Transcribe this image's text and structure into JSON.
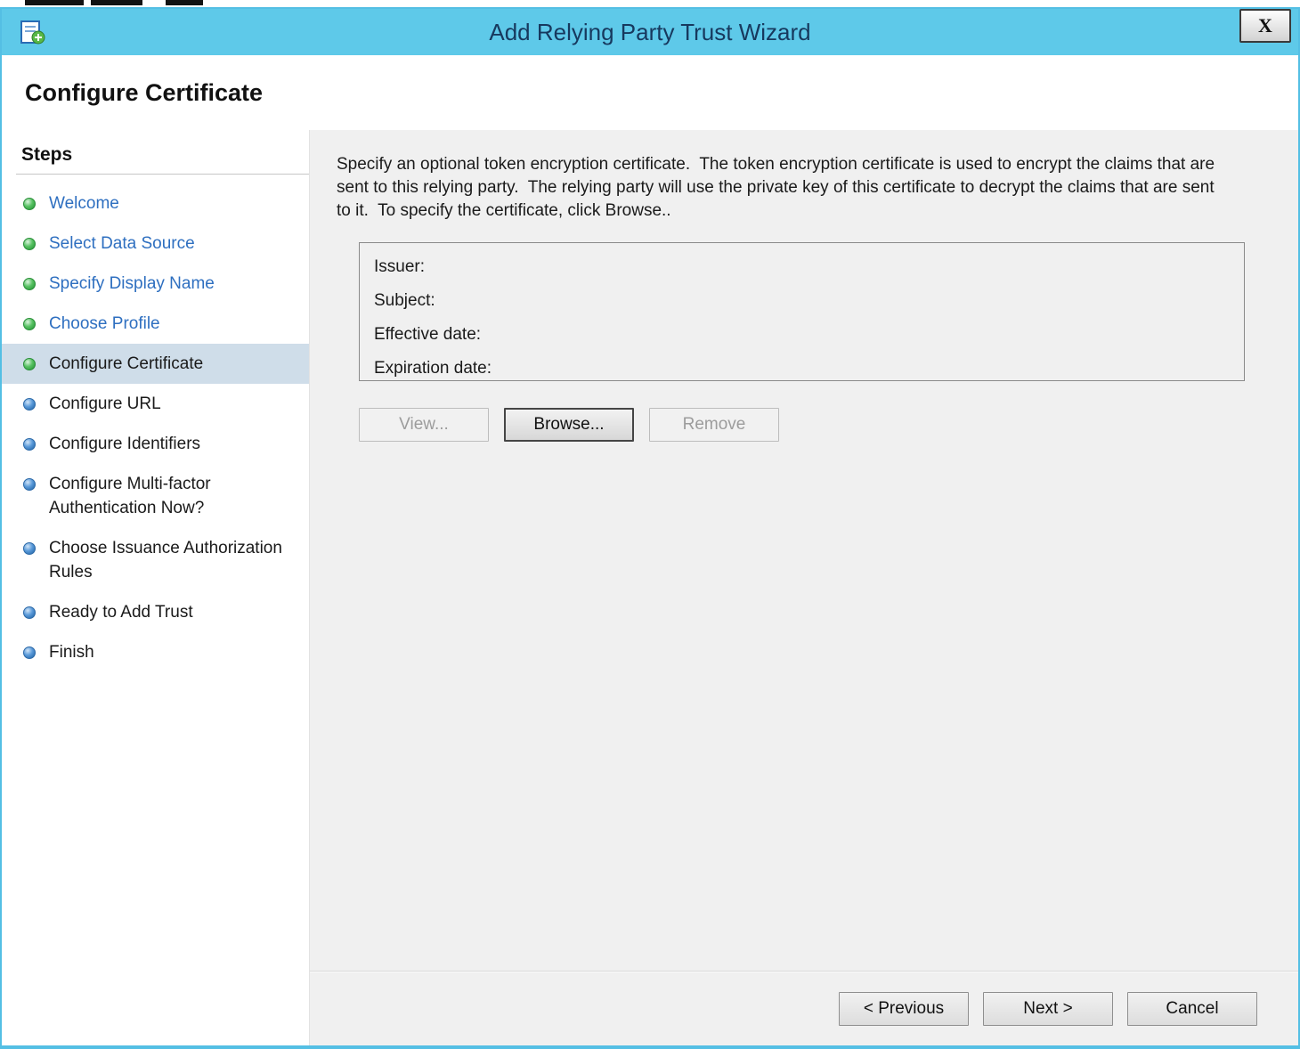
{
  "window": {
    "title": "Add Relying Party Trust Wizard",
    "close_glyph": "X"
  },
  "header": {
    "title": "Configure Certificate"
  },
  "sidebar": {
    "heading": "Steps",
    "items": [
      {
        "label": "Welcome",
        "state": "completed"
      },
      {
        "label": "Select Data Source",
        "state": "completed"
      },
      {
        "label": "Specify Display Name",
        "state": "completed"
      },
      {
        "label": "Choose Profile",
        "state": "completed"
      },
      {
        "label": "Configure Certificate",
        "state": "current"
      },
      {
        "label": "Configure URL",
        "state": "pending"
      },
      {
        "label": "Configure Identifiers",
        "state": "pending"
      },
      {
        "label": "Configure Multi-factor Authentication Now?",
        "state": "pending"
      },
      {
        "label": "Choose Issuance Authorization Rules",
        "state": "pending"
      },
      {
        "label": "Ready to Add Trust",
        "state": "pending"
      },
      {
        "label": "Finish",
        "state": "pending"
      }
    ]
  },
  "content": {
    "description": "Specify an optional token encryption certificate.  The token encryption certificate is used to encrypt the claims that are sent to this relying party.  The relying party will use the private key of this certificate to decrypt the claims that are sent to it.  To specify the certificate, click Browse..",
    "certificate": {
      "fields": [
        "Issuer:",
        "Subject:",
        "Effective date:",
        "Expiration date:"
      ]
    },
    "buttons": {
      "view": "View...",
      "browse": "Browse...",
      "remove": "Remove"
    }
  },
  "footer": {
    "previous": "< Previous",
    "next": "Next >",
    "cancel": "Cancel"
  },
  "colors": {
    "titlebar": "#5ec9e9",
    "step_completed": "#3aae4c",
    "step_pending": "#2d6fb0",
    "completed_link": "#2e6fc0",
    "current_highlight": "#cfdde9"
  }
}
